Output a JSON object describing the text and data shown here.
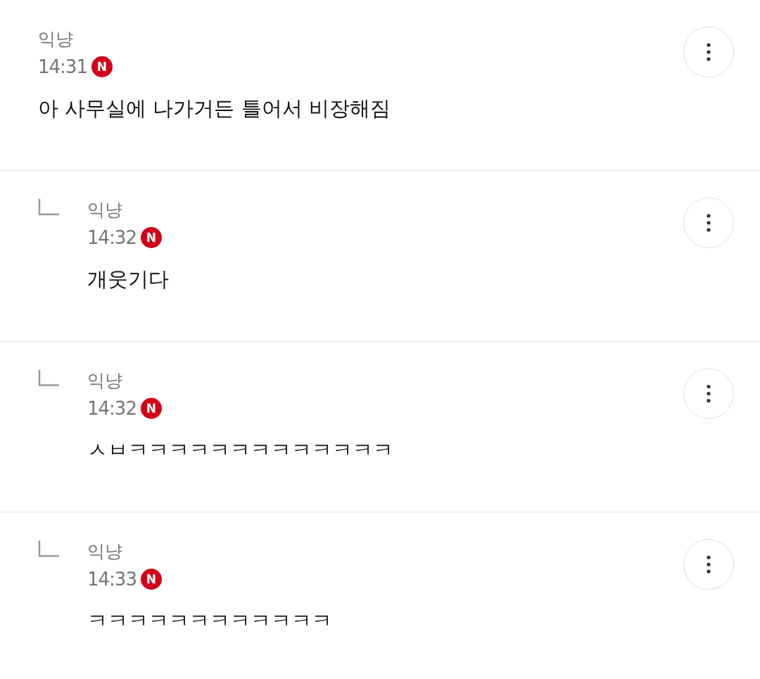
{
  "comments": [
    {
      "reply": false,
      "author": "익냥",
      "time": "14:31",
      "badge": "N",
      "body": "아 사무실에 나가거든 틀어서 비장해짐"
    },
    {
      "reply": true,
      "author": "익냥",
      "time": "14:32",
      "badge": "N",
      "body": "개웃기다"
    },
    {
      "reply": true,
      "author": "익냥",
      "time": "14:32",
      "badge": "N",
      "body": "ㅅㅂㅋㅋㅋㅋㅋㅋㅋㅋㅋㅋㅋㅋㅋ"
    },
    {
      "reply": true,
      "author": "익냥",
      "time": "14:33",
      "badge": "N",
      "body": "ㅋㅋㅋㅋㅋㅋㅋㅋㅋㅋㅋㅋ"
    }
  ]
}
